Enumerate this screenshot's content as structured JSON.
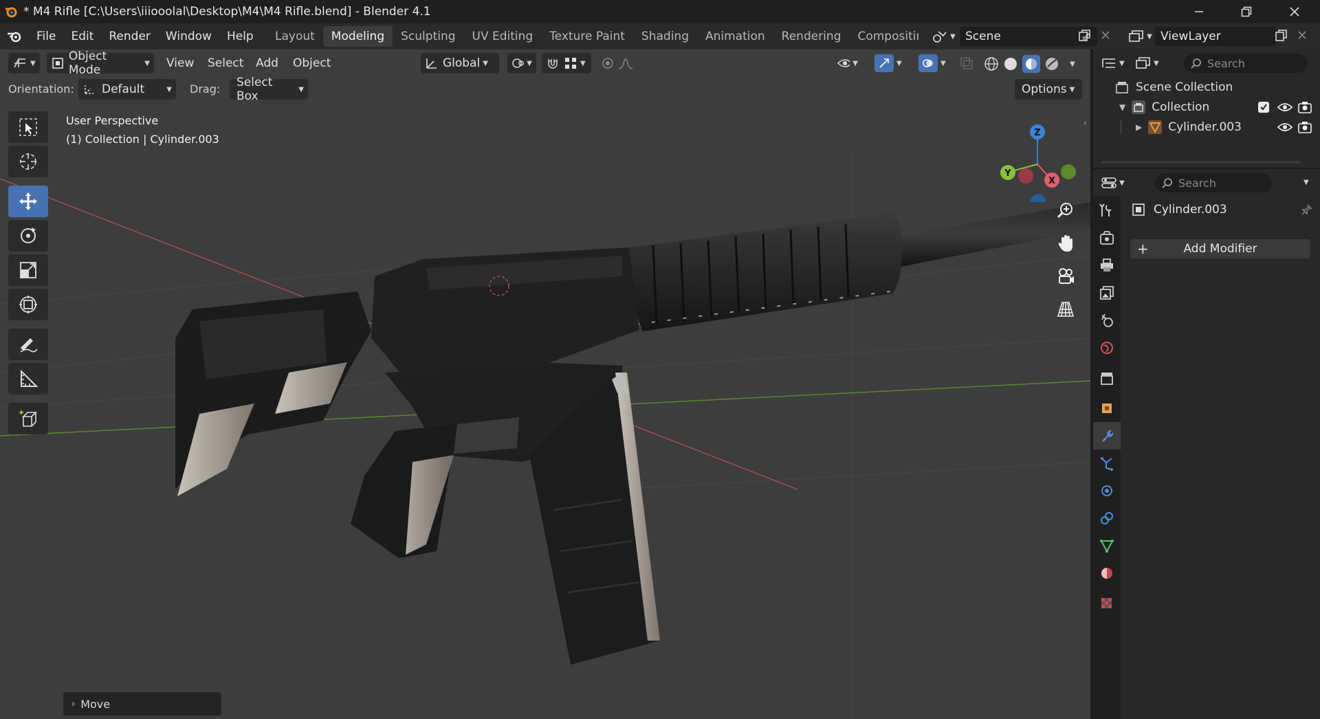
{
  "window": {
    "title": "* M4 Rifle [C:\\Users\\iiiooolal\\Desktop\\M4\\M4 Rifle.blend] - Blender 4.1",
    "controls": [
      "minimize",
      "maximize",
      "close"
    ]
  },
  "menu": {
    "items": [
      "File",
      "Edit",
      "Render",
      "Window",
      "Help"
    ]
  },
  "workspaces": {
    "tabs": [
      "Layout",
      "Modeling",
      "Sculpting",
      "UV Editing",
      "Texture Paint",
      "Shading",
      "Animation",
      "Rendering",
      "Compositing"
    ],
    "active": "Modeling"
  },
  "scene": {
    "label": "Scene",
    "view_layer": "ViewLayer"
  },
  "viewport_header": {
    "mode": "Object Mode",
    "menus": [
      "View",
      "Select",
      "Add",
      "Object"
    ],
    "transform_orientation": "Global"
  },
  "tool_settings": {
    "orientation_label": "Orientation:",
    "orientation_value": "Default",
    "drag_label": "Drag:",
    "drag_value": "Select Box",
    "options": "Options"
  },
  "viewport": {
    "perspective": "User Perspective",
    "context": "(1) Collection | Cylinder.003",
    "gizmo_axes": [
      "Z",
      "Y",
      "X"
    ],
    "last_operator": "Move"
  },
  "outliner": {
    "search_placeholder": "Search",
    "root": "Scene Collection",
    "collection": "Collection",
    "object": "Cylinder.003"
  },
  "properties": {
    "search_placeholder": "Search",
    "object_name": "Cylinder.003",
    "add_modifier": "Add Modifier",
    "active_tab": "modifiers"
  },
  "colors": {
    "accent": "#4772b3",
    "x_axis": "#e06070",
    "y_axis": "#8ac23a",
    "z_axis": "#3b82d8"
  }
}
